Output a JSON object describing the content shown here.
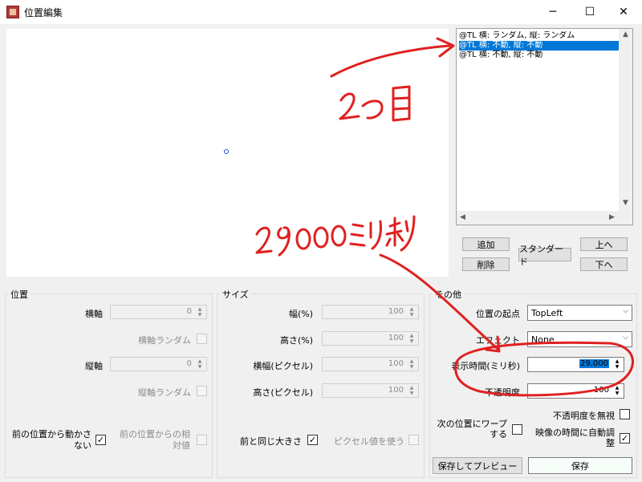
{
  "window": {
    "title": "位置編集",
    "minimize": "─",
    "maximize": "☐",
    "close": "✕"
  },
  "list": {
    "items": [
      "@TL 横: ランダム, 縦: ランダム",
      "@TL 横: 不動, 縦: 不動",
      "@TL 横: 不動, 縦: 不動"
    ],
    "selected_index": 1
  },
  "buttons": {
    "add": "追加",
    "delete": "削除",
    "standard": "スタンダード",
    "up": "上へ",
    "down": "下へ",
    "save_preview": "保存してプレビュー",
    "save": "保存"
  },
  "position": {
    "title": "位置",
    "x_label": "横軸",
    "x_value": "0",
    "x_random_label": "横軸ランダム",
    "y_label": "縦軸",
    "y_value": "0",
    "y_random_label": "縦軸ランダム",
    "move_from_prev_label": "前の位置から動かさない",
    "relative_label": "前の位置からの相対値"
  },
  "size": {
    "title": "サイズ",
    "width_pct_label": "幅(%)",
    "width_pct": "100",
    "height_pct_label": "高さ(%)",
    "height_pct": "100",
    "width_px_label": "横幅(ピクセル)",
    "width_px": "100",
    "height_px_label": "高さ(ピクセル)",
    "height_px": "100",
    "same_size_label": "前と同じ大きさ",
    "use_pixel_label": "ピクセル値を使う"
  },
  "other": {
    "title": "その他",
    "origin_label": "位置の起点",
    "origin_value": "TopLeft",
    "effect_label": "エフェクト",
    "effect_value": "None",
    "display_time_label": "表示時間(ミリ秒)",
    "display_time": "29,000",
    "opacity_label": "不透明度",
    "opacity": "100",
    "ignore_opacity_label": "不透明度を無視",
    "warp_label": "次の位置にワープする",
    "auto_adjust_label": "映像の時間に自動調整"
  },
  "annotations": {
    "note1": "2つ目",
    "note2": "29000ミリ秒",
    "ink_color": "#e02020"
  }
}
